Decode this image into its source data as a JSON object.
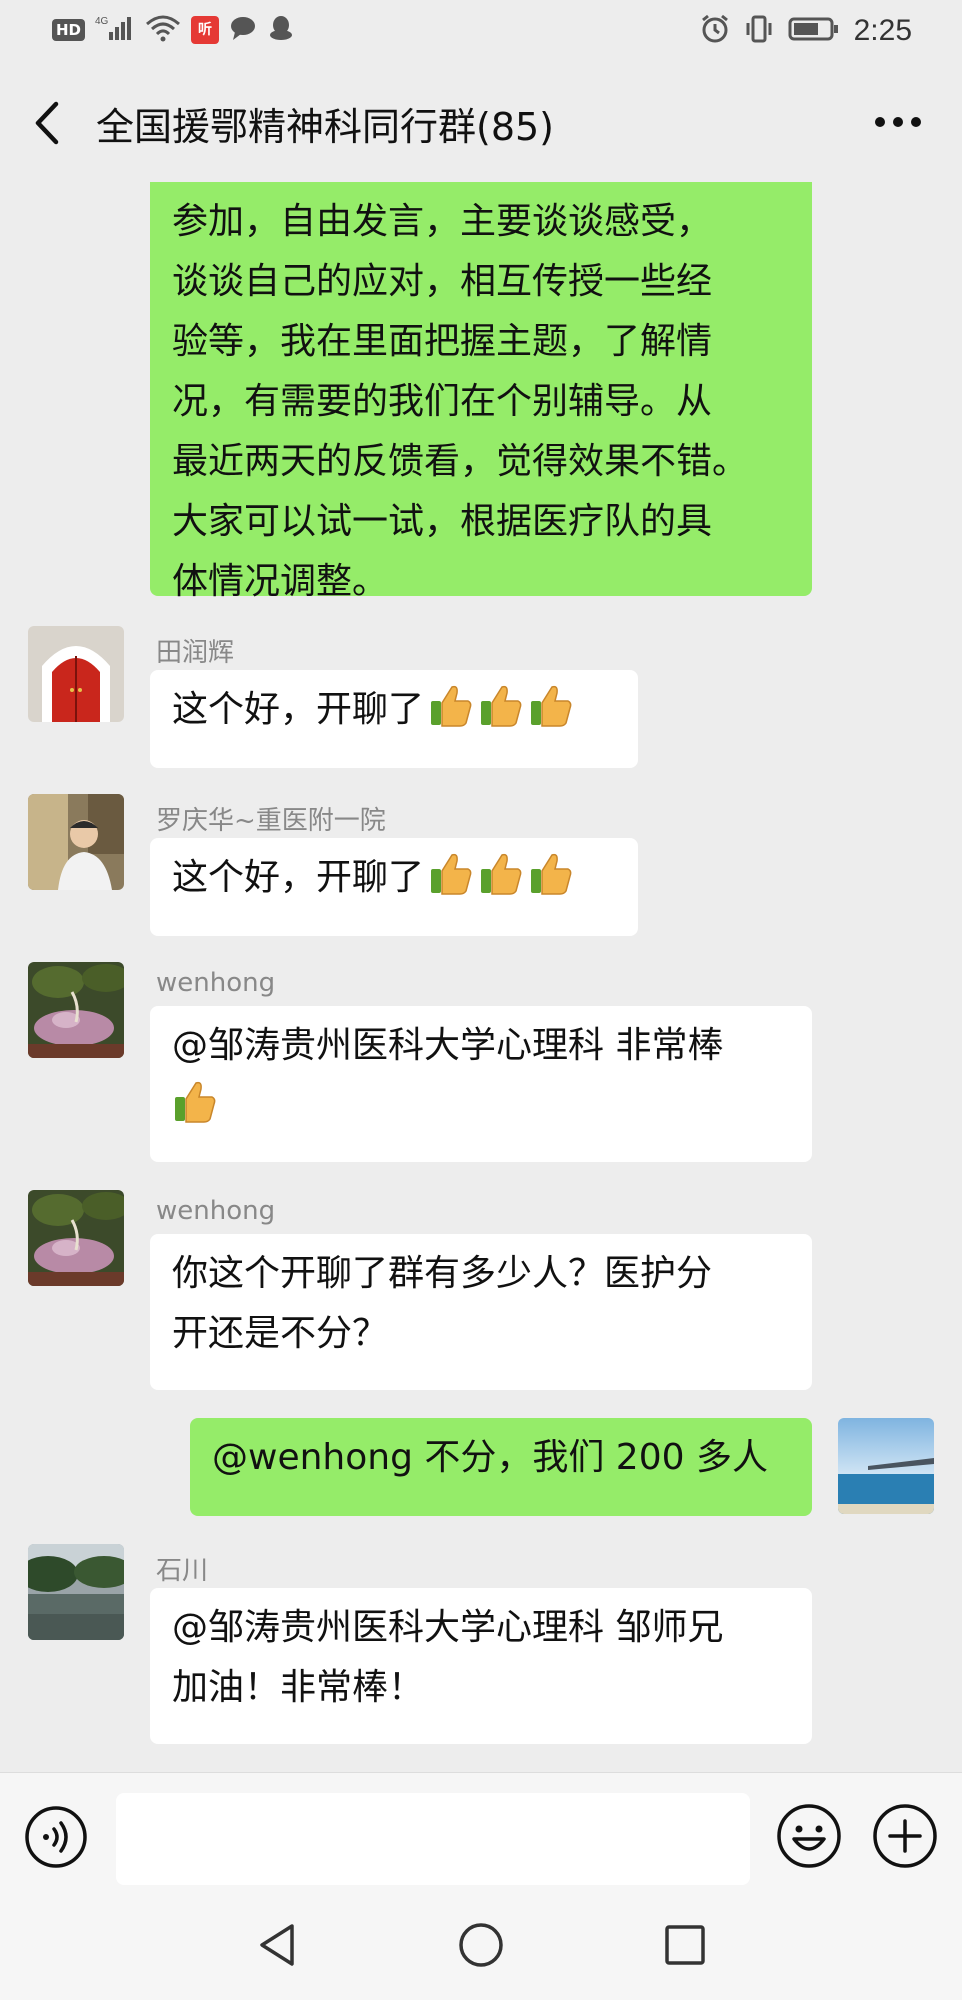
{
  "status_bar": {
    "hd_label": "HD",
    "network_label": "4G",
    "app_badge": "听",
    "time": "2:25"
  },
  "header": {
    "title": "全国援鄂精神科同行群(85)"
  },
  "messages": [
    {
      "side": "right",
      "sender": "",
      "lines": [
        "参加，自由发言，主要谈谈感受，",
        "谈谈自己的应对，相互传授一些经",
        "验等，我在里面把握主题，了解情",
        "况，有需要的我们在个别辅导。从",
        "最近两天的反馈看，觉得效果不错。",
        "大家可以试一试，根据医疗队的具",
        "体情况调整。"
      ]
    },
    {
      "side": "left",
      "sender": "田润辉",
      "lines": [
        "这个好，开聊了"
      ],
      "thumbs": 3
    },
    {
      "side": "left",
      "sender": "罗庆华~重医附一院",
      "lines": [
        "这个好，开聊了"
      ],
      "thumbs": 3
    },
    {
      "side": "left",
      "sender": "wenhong",
      "lines": [
        "@邹涛贵州医科大学心理科  非常棒"
      ],
      "thumbs": 1
    },
    {
      "side": "left",
      "sender": "wenhong",
      "lines": [
        "你这个开聊了群有多少人？医护分",
        "开还是不分？"
      ]
    },
    {
      "side": "right",
      "sender": "",
      "lines": [
        "@wenhong 不分，我们 200 多人"
      ]
    },
    {
      "side": "left",
      "sender": "石川",
      "lines": [
        "@邹涛贵州医科大学心理科  邹师兄",
        "加油！非常棒！"
      ]
    }
  ],
  "input_bar": {
    "placeholder": "",
    "voice_icon": "voice-icon",
    "emoji_icon": "emoji-icon",
    "plus_icon": "plus-icon"
  },
  "colors": {
    "background": "#ededed",
    "green_bubble": "#95ec69",
    "white_bubble": "#ffffff",
    "sender_name": "#888888"
  }
}
